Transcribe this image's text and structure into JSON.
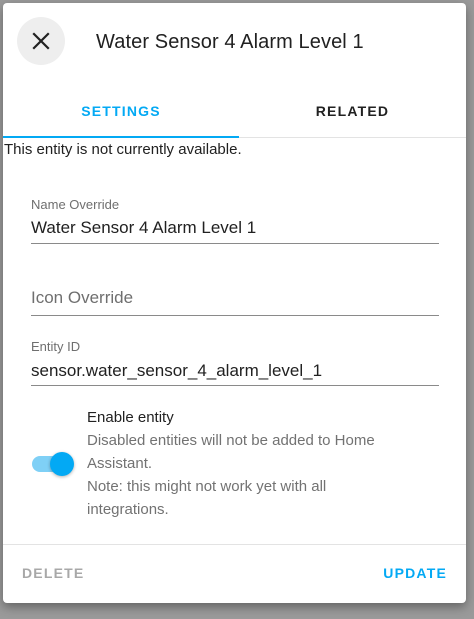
{
  "dialog": {
    "title": "Water Sensor 4 Alarm Level 1",
    "close_icon": "close-icon"
  },
  "tabs": [
    {
      "label": "SETTINGS",
      "active": true
    },
    {
      "label": "RELATED",
      "active": false
    }
  ],
  "status_message": "This entity is not currently available.",
  "fields": {
    "name_override": {
      "label": "Name Override",
      "value": "Water Sensor 4 Alarm Level 1"
    },
    "icon_override": {
      "placeholder": "Icon Override",
      "value": ""
    },
    "entity_id": {
      "label": "Entity ID",
      "value": "sensor.water_sensor_4_alarm_level_1"
    }
  },
  "enable_entity": {
    "enabled": true,
    "label": "Enable entity",
    "description_line1": "Disabled entities will not be added to Home",
    "description_line2": "Assistant.",
    "note_line1": "Note: this might not work yet with all",
    "note_line2": "integrations."
  },
  "footer": {
    "delete_label": "DELETE",
    "update_label": "UPDATE"
  },
  "colors": {
    "accent": "#03a9f4",
    "toggle_track": "#7fd0f6",
    "disabled_text": "#a8a8a8",
    "backdrop": "#9a9a9a"
  }
}
